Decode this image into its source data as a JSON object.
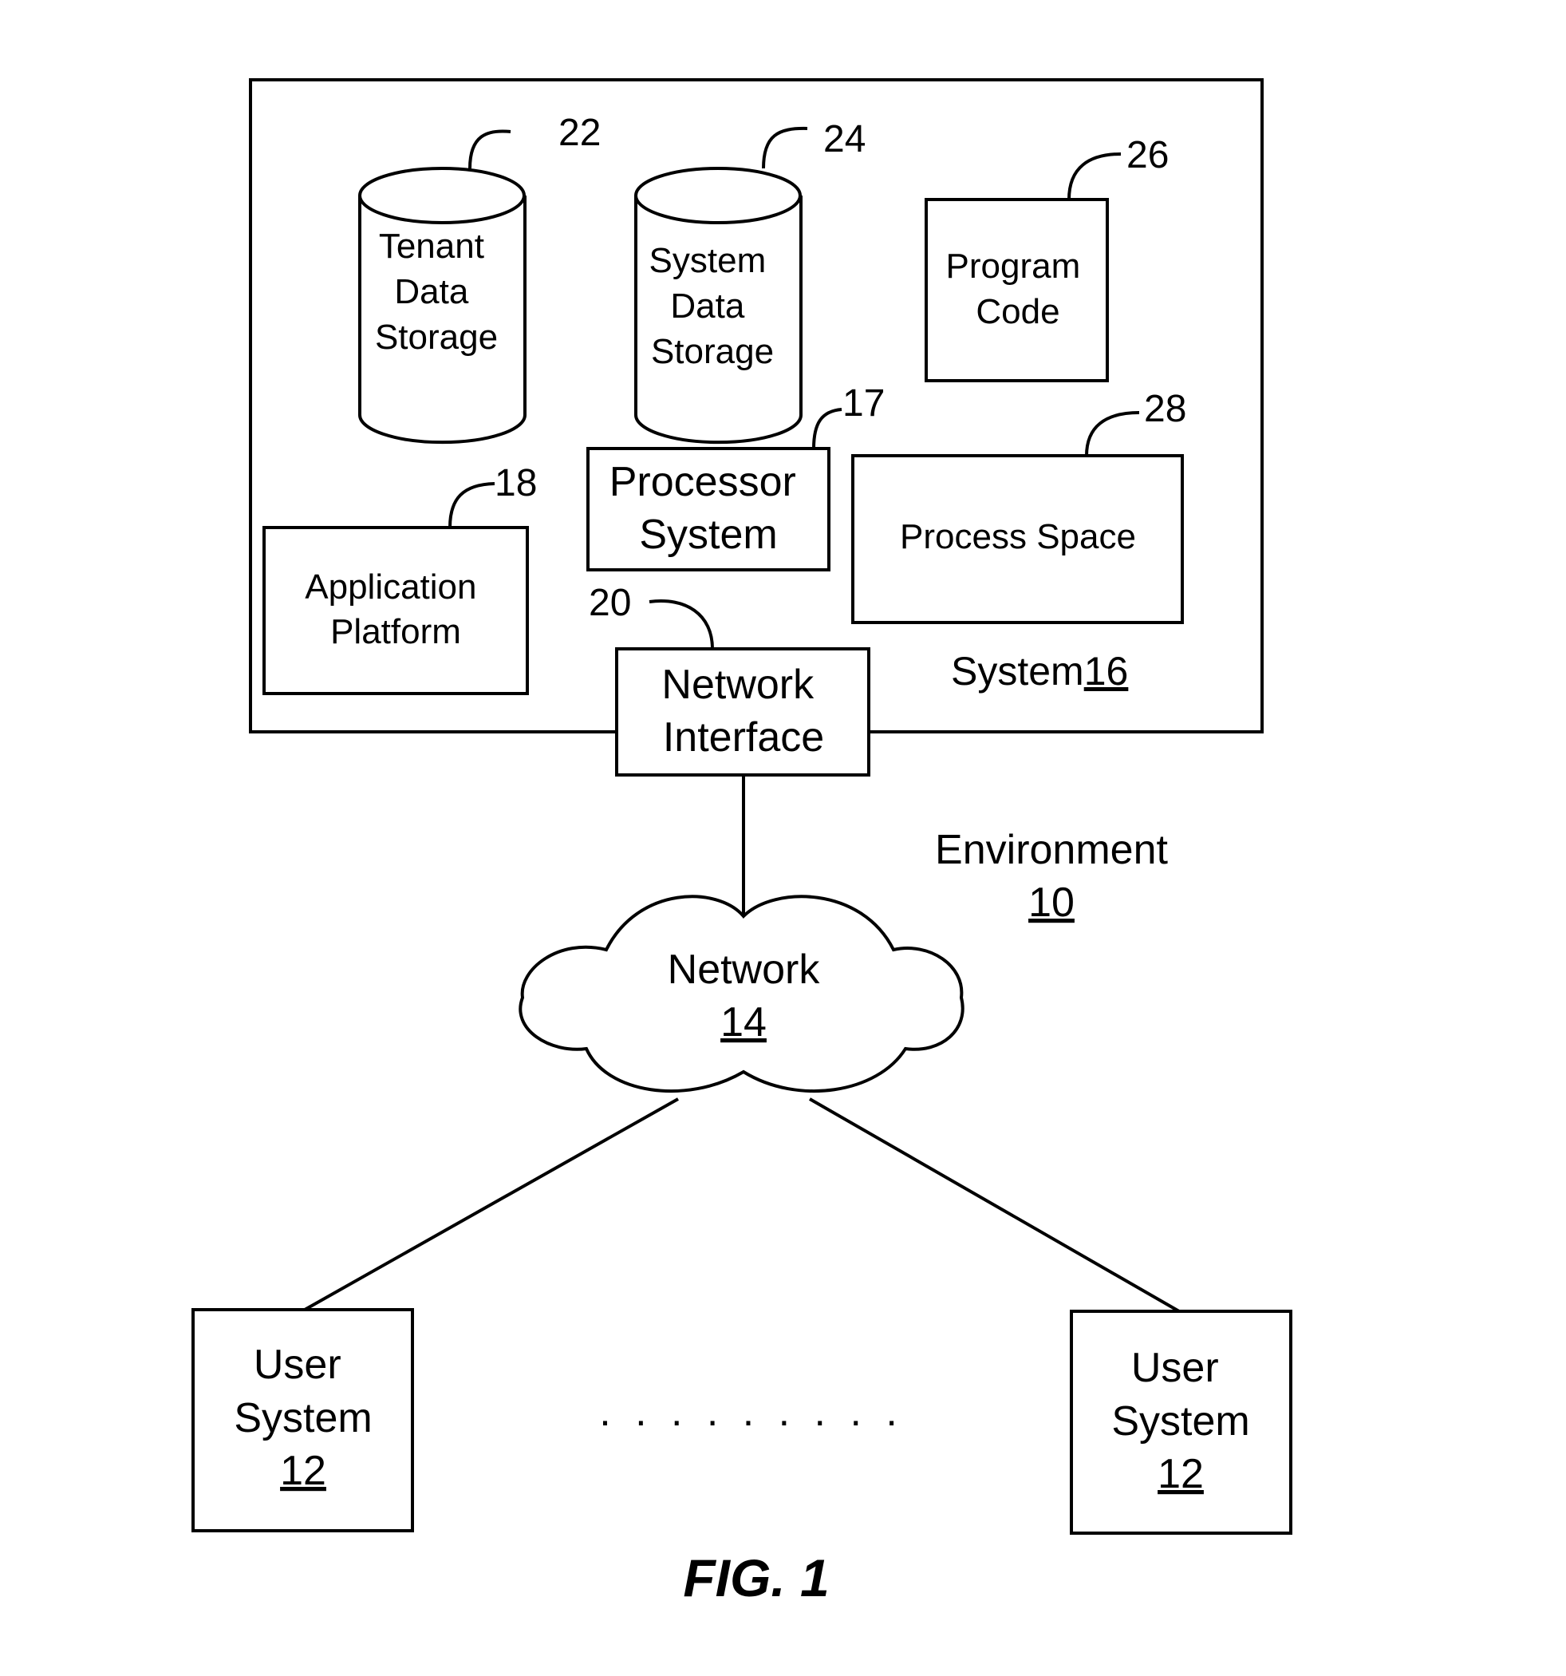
{
  "system": {
    "label": "System",
    "ref": "16",
    "components": {
      "tenant_storage": {
        "lines": [
          "Tenant",
          "Data",
          "Storage"
        ],
        "ref": "22"
      },
      "system_storage": {
        "lines": [
          "System",
          "Data",
          "Storage"
        ],
        "ref": "24"
      },
      "program_code": {
        "lines": [
          "Program",
          "Code"
        ],
        "ref": "26"
      },
      "processor_system": {
        "lines": [
          "Processor",
          "System"
        ],
        "ref": "17"
      },
      "process_space": {
        "lines": [
          "Process Space"
        ],
        "ref": "28"
      },
      "application_platform": {
        "lines": [
          "Application",
          "Platform"
        ],
        "ref": "18"
      },
      "network_interface": {
        "lines": [
          "Network",
          "Interface"
        ],
        "ref": "20"
      }
    }
  },
  "environment": {
    "label": "Environment",
    "ref": "10"
  },
  "network": {
    "label": "Network",
    "ref": "14"
  },
  "user_systems": [
    {
      "lines": [
        "User",
        "System"
      ],
      "ref": "12"
    },
    {
      "lines": [
        "User",
        "System"
      ],
      "ref": "12"
    }
  ],
  "ellipsis": ". . . . . . . . .",
  "figure_caption": "FIG. 1"
}
